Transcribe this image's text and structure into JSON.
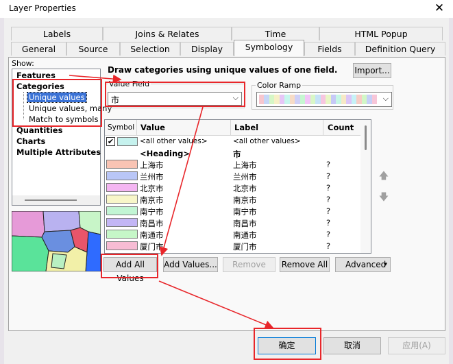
{
  "window": {
    "title": "Layer Properties"
  },
  "tabs_row1": [
    "Labels",
    "Joins & Relates",
    "Time",
    "HTML Popup"
  ],
  "tabs_row2": [
    "General",
    "Source",
    "Selection",
    "Display",
    "Symbology",
    "Fields",
    "Definition Query"
  ],
  "active_tab": "Symbology",
  "show_label": "Show:",
  "tree": {
    "features": "Features",
    "categories": "Categories",
    "cat_items": [
      "Unique values",
      "Unique values, many",
      "Match to symbols in a"
    ],
    "quantities": "Quantities",
    "charts": "Charts",
    "multiple": "Multiple Attributes"
  },
  "heading_text": "Draw categories using unique values of one field.",
  "import_label": "Import...",
  "value_field": {
    "label": "Value Field",
    "value": "市"
  },
  "color_ramp": {
    "label": "Color Ramp",
    "colors": [
      "#f7c6ce",
      "#c6d6f7",
      "#d6f7c6",
      "#f7f0c6",
      "#e6c6f7",
      "#c6f7ee",
      "#f7dcc6",
      "#cfd0f7",
      "#c6f7d1",
      "#f2c6f7",
      "#d9f7c6",
      "#c6e3f7",
      "#f7c6e0",
      "#e9f7c6",
      "#c6c9f7",
      "#c6f7e6",
      "#f7e9c6",
      "#dcc6f7",
      "#c6f2f7",
      "#f7cdc6",
      "#d2f7c6",
      "#c6d0f7",
      "#f7c6d8"
    ]
  },
  "table": {
    "headers": [
      "Symbol",
      "Value",
      "Label",
      "Count"
    ],
    "all_other": {
      "value": "<all other values>",
      "label": "<all other values>",
      "color": "#c6f2ee"
    },
    "heading_row": {
      "value": "<Heading>",
      "label": "市"
    },
    "rows": [
      {
        "value": "上海市",
        "label": "上海市",
        "count": "?",
        "color": "#f9c4b4"
      },
      {
        "value": "兰州市",
        "label": "兰州市",
        "count": "?",
        "color": "#b9c6f7"
      },
      {
        "value": "北京市",
        "label": "北京市",
        "count": "?",
        "color": "#f4b6f2"
      },
      {
        "value": "南京市",
        "label": "南京市",
        "count": "?",
        "color": "#f8f6c9"
      },
      {
        "value": "南宁市",
        "label": "南宁市",
        "count": "?",
        "color": "#c2f5d4"
      },
      {
        "value": "南昌市",
        "label": "南昌市",
        "count": "?",
        "color": "#c3b6f5"
      },
      {
        "value": "南通市",
        "label": "南通市",
        "count": "?",
        "color": "#c6f7c8"
      },
      {
        "value": "厦门市",
        "label": "厦门市",
        "count": "?",
        "color": "#f7bcd4"
      },
      {
        "value": "",
        "label": "",
        "count": "?",
        "color": "#c8e8f7"
      }
    ]
  },
  "buttons": {
    "add_all": "Add All Values",
    "add_values": "Add Values...",
    "remove": "Remove",
    "remove_all": "Remove All",
    "advanced": "Advanced"
  },
  "footer": {
    "ok": "确定",
    "cancel": "取消",
    "apply": "应用(A)"
  }
}
